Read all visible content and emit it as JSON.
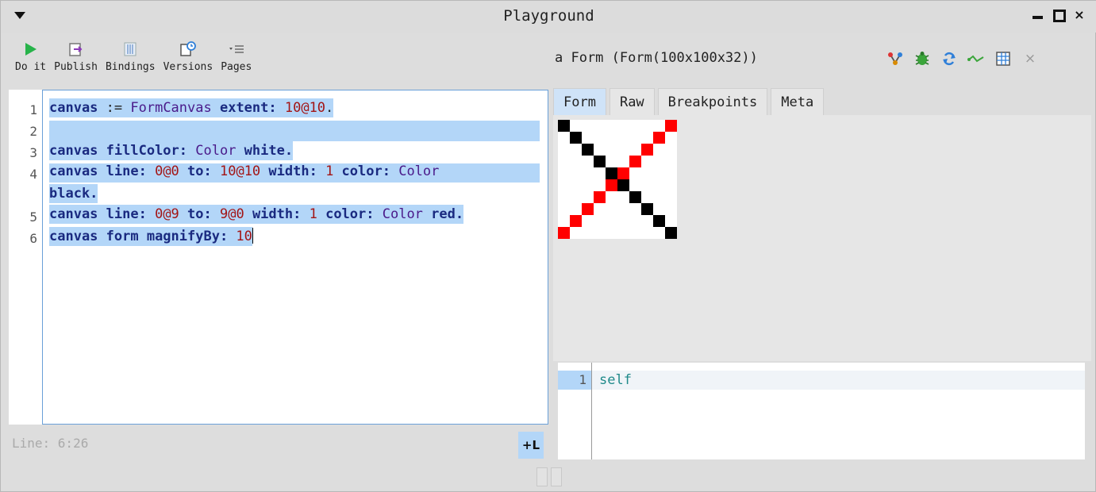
{
  "window": {
    "title": "Playground"
  },
  "toolbar": {
    "items": [
      {
        "label": "Do it",
        "icon": "play-icon"
      },
      {
        "label": "Publish",
        "icon": "publish-icon"
      },
      {
        "label": "Bindings",
        "icon": "bindings-icon"
      },
      {
        "label": "Versions",
        "icon": "versions-icon"
      },
      {
        "label": "Pages",
        "icon": "pages-icon"
      }
    ]
  },
  "editor": {
    "line_numbers": [
      "1",
      "2",
      "3",
      "4",
      "5",
      "6"
    ],
    "status": "Line: 6:26",
    "line_toggle_label": "+L",
    "lines": {
      "l1": [
        "canvas",
        " := ",
        "FormCanvas",
        " extent: ",
        "10@10",
        "."
      ],
      "l3": [
        "canvas",
        " fillColor: ",
        "Color",
        " white."
      ],
      "l4a": [
        "canvas",
        " line: ",
        "0@0",
        " to: ",
        "10@10",
        " width: ",
        "1",
        " color: ",
        "Color"
      ],
      "l4b": [
        "black."
      ],
      "l5": [
        "canvas",
        " line: ",
        "0@9",
        " to: ",
        "9@0",
        " width: ",
        "1",
        " color: ",
        "Color",
        " red."
      ],
      "l6": [
        "canvas",
        " form magnifyBy: ",
        "10"
      ]
    }
  },
  "inspector": {
    "title": "a Form (Form(100x100x32))",
    "icons": [
      "explore-icon",
      "debug-bug-icon",
      "refresh-icon",
      "inspect-icon",
      "spreadsheet-icon",
      "close-icon"
    ],
    "tabs": [
      "Form",
      "Raw",
      "Breakpoints",
      "Meta"
    ],
    "active_tab": "Form",
    "form_pixels": {
      "size": 10,
      "black_diagonal": "0@0 to 10@10",
      "red_diagonal": "0@9 to 9@0",
      "colors": {
        "black": "#000000",
        "red": "#ff0000",
        "background": "#ffffff"
      }
    },
    "eval": {
      "line_number": "1",
      "code": "self"
    }
  },
  "colors": {
    "selection": "#b3d6f8",
    "accent_blue": "#2f7fd8",
    "play_green": "#27b34a"
  }
}
